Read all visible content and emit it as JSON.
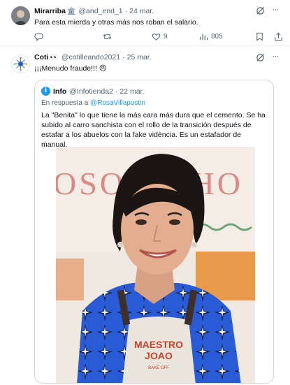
{
  "tweet1": {
    "name": "Mirarriba",
    "badge": "🏛️",
    "handle": "@and_end_1",
    "dot": "·",
    "date": "24 mar.",
    "text": "Para esta mierda y otras más nos roban el salario.",
    "actions": {
      "reply_count": "",
      "retweet_count": "",
      "like_count": "9",
      "views_count": "805"
    }
  },
  "tweet2": {
    "name": "Coti",
    "badge": "👀",
    "handle": "@cotilleando2021",
    "dot": "·",
    "date": "25 mar.",
    "text": "¡¡¡Menudo fraude!!! 😠",
    "quote": {
      "avatar_letter": "i",
      "name": "Info",
      "handle": "@Infotienda2",
      "dot": "·",
      "date": "22 mar.",
      "reply_prefix": "En respuesta a",
      "reply_mention": "@RosaVillapostin",
      "text": "La \"Benita\" lo que tiene la más cara más dura que el cemento. Se ha subido al carro sanchista con el rollo de la transición después de estafar a los abuelos con la fake vidència. Es un estafador de manual.",
      "photo": {
        "backdrop_text": "OSO EL HO",
        "apron_line1": "MAESTRO",
        "apron_line2": "JOAO",
        "apron_small": "BAKE OFF"
      }
    }
  },
  "colors": {
    "accent": "#1d9bf0",
    "muted": "#536471",
    "border": "#cfd9de",
    "jacket": "#2a5bd7",
    "apron": "#e9e5dc",
    "apron_text": "#c2452d"
  }
}
